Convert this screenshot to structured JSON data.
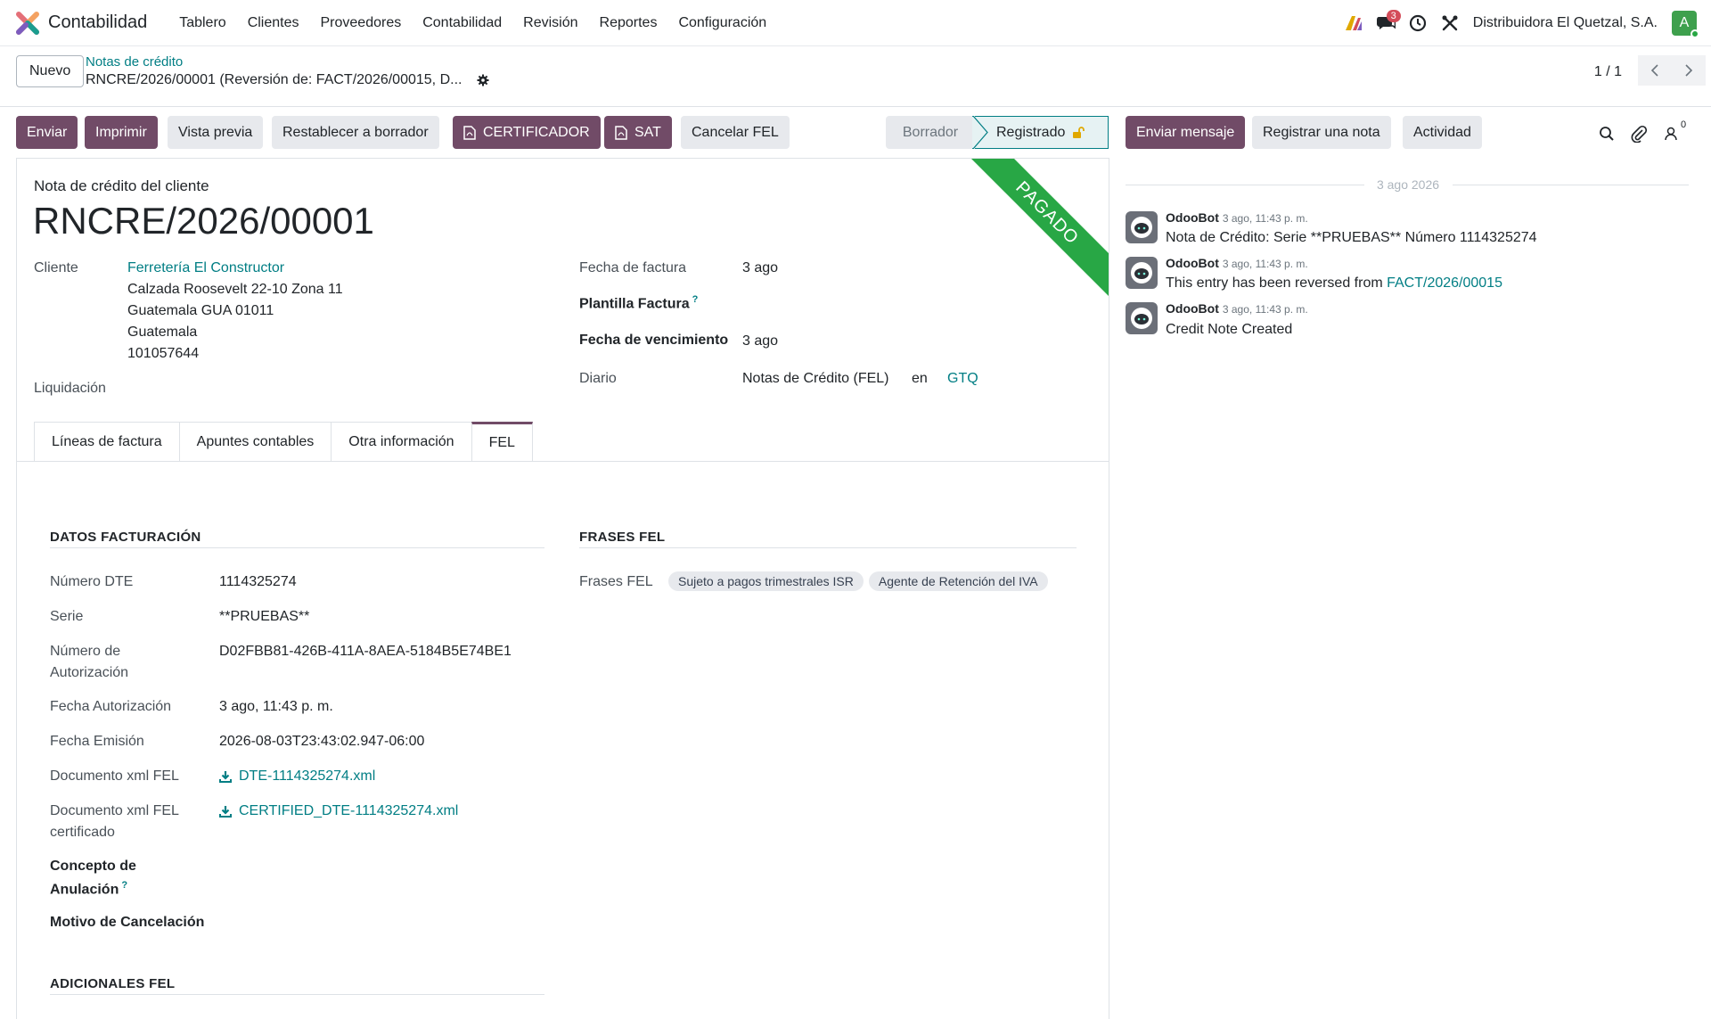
{
  "navbar": {
    "app_name": "Contabilidad",
    "menu": [
      "Tablero",
      "Clientes",
      "Proveedores",
      "Contabilidad",
      "Revisión",
      "Reportes",
      "Configuración"
    ],
    "messages_count": "3",
    "company": "Distribuidora El Quetzal, S.A.",
    "avatar_letter": "A"
  },
  "control_panel": {
    "new_label": "Nuevo",
    "breadcrumb": "Notas de crédito",
    "record_title": "RNCRE/2026/00001 (Reversión de: FACT/2026/00015, D...",
    "pager": "1 / 1"
  },
  "actions": {
    "send": "Enviar",
    "print": "Imprimir",
    "preview": "Vista previa",
    "reset": "Restablecer a borrador",
    "certificador": "CERTIFICADOR",
    "sat": "SAT",
    "cancel_fel": "Cancelar FEL"
  },
  "status": {
    "draft": "Borrador",
    "posted": "Registrado"
  },
  "chatter_buttons": {
    "send_message": "Enviar mensaje",
    "log_note": "Registrar una nota",
    "activity": "Actividad",
    "followers_count": "0"
  },
  "form": {
    "ribbon": "PAGADO",
    "subtitle": "Nota de crédito del cliente",
    "title": "RNCRE/2026/00001",
    "customer_label": "Cliente",
    "customer_name": "Ferretería El Constructor",
    "customer_address": [
      "Calzada Roosevelt 22-10 Zona 11",
      "Guatemala GUA 01011",
      "Guatemala",
      "101057644"
    ],
    "liquidacion_label": "Liquidación",
    "invoice_date_label": "Fecha de factura",
    "invoice_date": "3 ago",
    "template_label": "Plantilla Factura",
    "help_mark": "?",
    "due_date_label": "Fecha de vencimiento",
    "due_date": "3 ago",
    "journal_label": "Diario",
    "journal": "Notas de Crédito (FEL)",
    "journal_in": "en",
    "currency": "GTQ"
  },
  "tabs": [
    "Líneas de factura",
    "Apuntes contables",
    "Otra información",
    "FEL"
  ],
  "fel": {
    "billing_title": "DATOS FACTURACIÓN",
    "phrases_title": "FRASES FEL",
    "numero_dte_label": "Número DTE",
    "numero_dte": "1114325274",
    "serie_label": "Serie",
    "serie": "**PRUEBAS**",
    "autorizacion_label_1": "Número de",
    "autorizacion_label_2": "Autorización",
    "autorizacion": "D02FBB81-426B-411A-8AEA-5184B5E74BE1",
    "fecha_aut_label": "Fecha Autorización",
    "fecha_aut": "3 ago, 11:43 p. m.",
    "fecha_emision_label": "Fecha Emisión",
    "fecha_emision": "2026-08-03T23:43:02.947-06:00",
    "xml_label": "Documento xml FEL",
    "xml_file": "DTE-1114325274.xml",
    "xml_cert_label_1": "Documento xml FEL",
    "xml_cert_label_2": "certificado",
    "xml_cert_file": "CERTIFIED_DTE-1114325274.xml",
    "concepto_label_1": "Concepto de",
    "concepto_label_2": "Anulación",
    "motivo_label": "Motivo de Cancelación",
    "adicionales_title": "ADICIONALES FEL",
    "frases_label": "Frases FEL",
    "frases": [
      "Sujeto a pagos trimestrales ISR",
      "Agente de Retención del IVA"
    ]
  },
  "chatter": {
    "date": "3 ago 2026",
    "messages": [
      {
        "author": "OdooBot",
        "time": "3 ago, 11:43 p. m.",
        "body": "Nota de Crédito: Serie **PRUEBAS** Número 1114325274"
      },
      {
        "author": "OdooBot",
        "time": "3 ago, 11:43 p. m.",
        "body": "This entry has been reversed from ",
        "link": "FACT/2026/00015"
      },
      {
        "author": "OdooBot",
        "time": "3 ago, 11:43 p. m.",
        "body": "Credit Note Created"
      }
    ]
  },
  "colors": {
    "primary": "#714b67",
    "link": "#017e84",
    "paid": "#28a745"
  },
  "icons": [
    "app-logo-icon",
    "ai-icon",
    "chat-icon",
    "clock-icon",
    "tools-icon",
    "gear-icon",
    "chevron-left-icon",
    "chevron-right-icon",
    "pdf-icon",
    "lock-open-icon",
    "search-icon",
    "paperclip-icon",
    "followers-icon",
    "download-icon",
    "bot-avatar-icon"
  ]
}
